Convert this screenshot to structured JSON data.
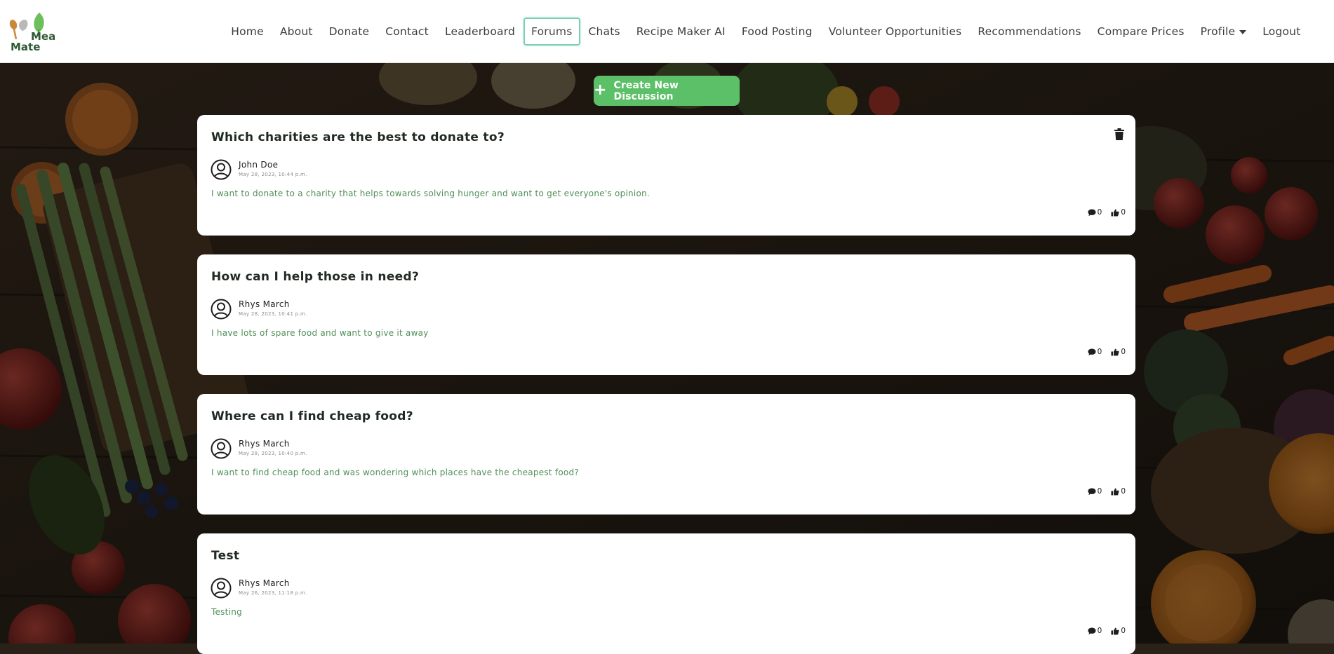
{
  "brand": {
    "logo_text_line1": "Meal",
    "logo_text_line2": "Mate"
  },
  "nav": {
    "items": [
      {
        "label": "Home"
      },
      {
        "label": "About"
      },
      {
        "label": "Donate"
      },
      {
        "label": "Contact"
      },
      {
        "label": "Leaderboard"
      },
      {
        "label": "Forums",
        "active": true
      },
      {
        "label": "Chats"
      },
      {
        "label": "Recipe Maker AI"
      },
      {
        "label": "Food Posting"
      },
      {
        "label": "Volunteer Opportunities"
      },
      {
        "label": "Recommendations"
      },
      {
        "label": "Compare Prices"
      },
      {
        "label": "Profile",
        "has_dropdown": true
      },
      {
        "label": "Logout"
      }
    ]
  },
  "forum": {
    "create_label": "Create New Discussion",
    "discussions": [
      {
        "title": "Which charities are the best to donate to?",
        "author": "John Doe",
        "date": "May 28, 2023, 10:44 p.m.",
        "body": "I want to donate to a charity that helps towards solving hunger and want to get everyone's opinion.",
        "comments": "0",
        "likes": "0",
        "deletable": true
      },
      {
        "title": "How can I help those in need?",
        "author": "Rhys March",
        "date": "May 28, 2023, 10:41 p.m.",
        "body": "I have lots of spare food and want to give it away",
        "comments": "0",
        "likes": "0"
      },
      {
        "title": "Where can I find cheap food?",
        "author": "Rhys March",
        "date": "May 28, 2023, 10:40 p.m.",
        "body": "I want to find cheap food and was wondering which places have the cheapest food?",
        "comments": "0",
        "likes": "0"
      },
      {
        "title": "Test",
        "author": "Rhys March",
        "date": "May 26, 2023, 11:18 p.m.",
        "body": "Testing",
        "comments": "0",
        "likes": "0"
      }
    ]
  },
  "icons": {
    "avatar": "user-circle-icon",
    "comment": "comment-icon",
    "like": "thumbs-up-icon",
    "delete": "trash-icon",
    "plus": "plus-icon",
    "dropdown": "caret-down-icon"
  },
  "colors": {
    "accent_green": "#5cc068",
    "body_text_green": "#4f8f57",
    "active_nav_border": "#7cd0b2"
  }
}
